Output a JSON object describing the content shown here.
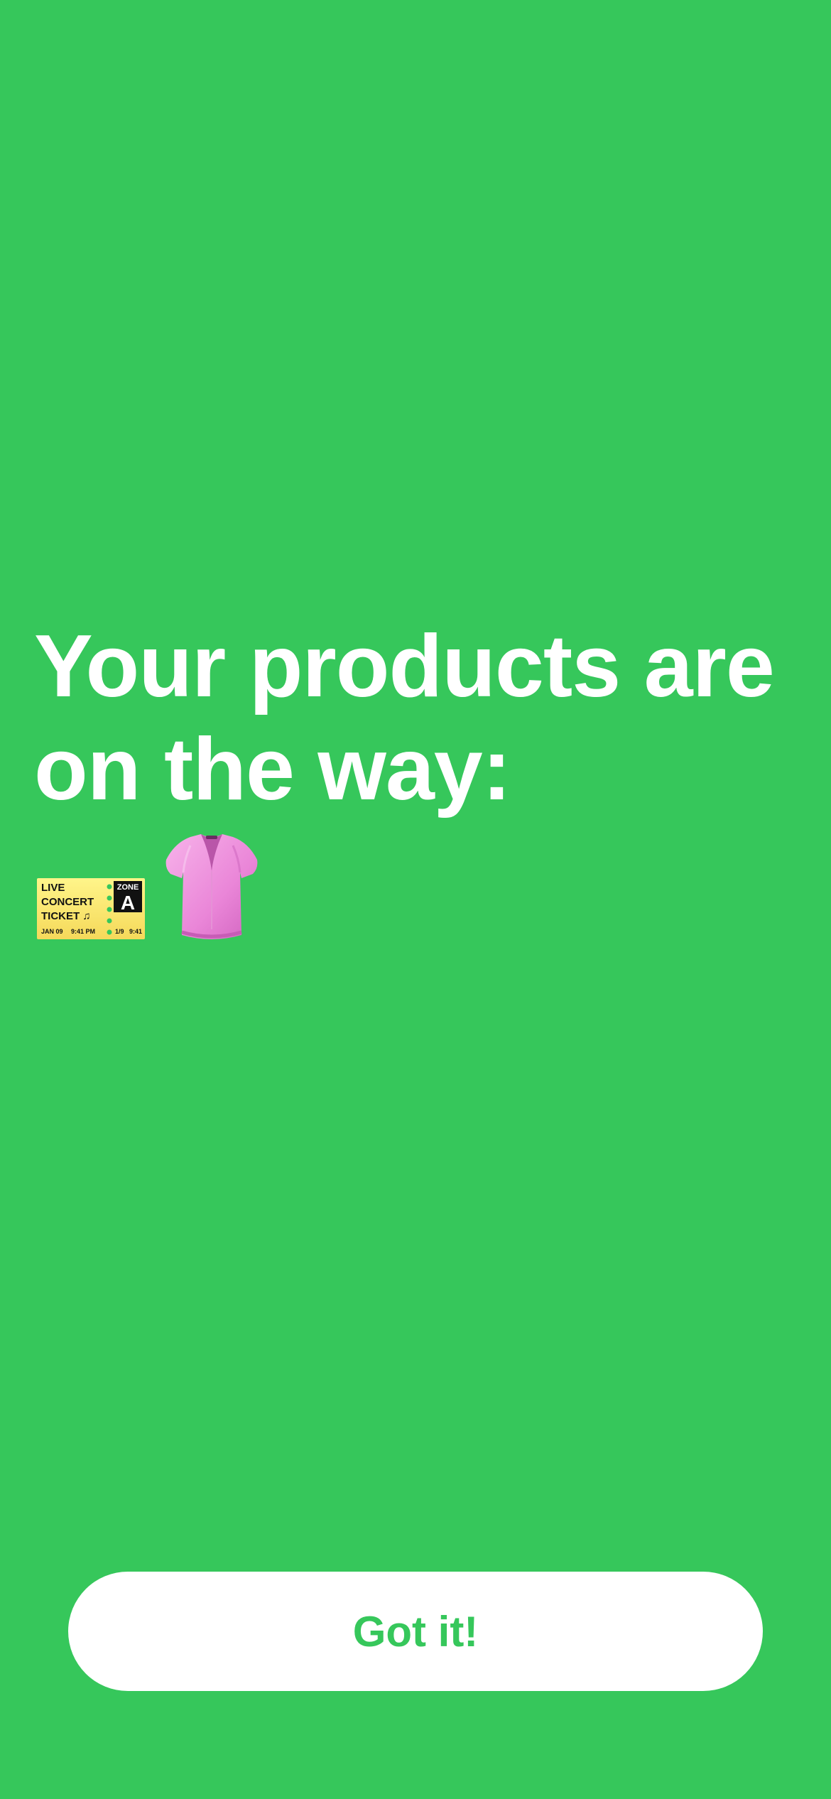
{
  "headline": {
    "line1": "Your products are",
    "line2": "on the way:"
  },
  "products": [
    {
      "icon": "concert-ticket-icon",
      "ticket": {
        "line1": "LIVE",
        "line2": "CONCERT",
        "line3": "TICKET ♫",
        "zone_label": "ZONE",
        "zone_value": "A",
        "date": "JAN 09",
        "time": "9:41 PM",
        "stub_left": "1/9",
        "stub_right": "9:41"
      }
    },
    {
      "icon": "blouse-icon"
    }
  ],
  "button": {
    "label": "Got it!"
  },
  "colors": {
    "background": "#36c75b",
    "button_bg": "#ffffff",
    "button_text": "#36c75b",
    "headline_text": "#ffffff"
  }
}
